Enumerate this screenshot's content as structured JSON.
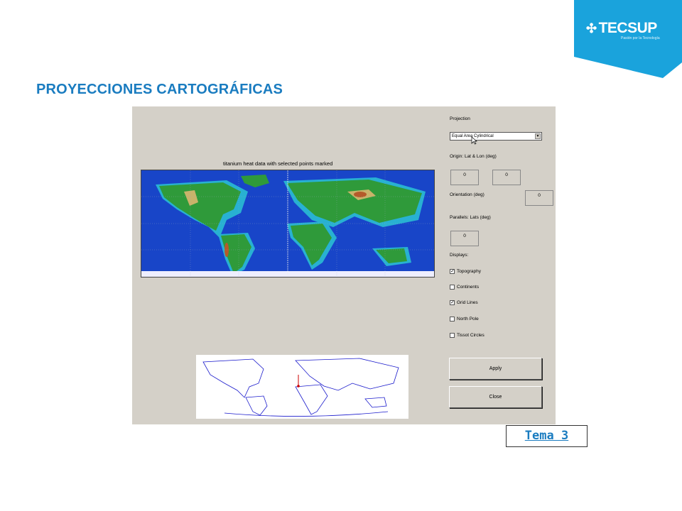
{
  "logo": {
    "brand": "TECSUP",
    "tagline": "Pasión por la Tecnología",
    "color": "#1aa3dc"
  },
  "slide": {
    "title": "PROYECCIONES CARTOGRÁFICAS",
    "title_color": "#1a7cc0",
    "tema_label": "Tema 3"
  },
  "app": {
    "plot_title": "titanium heat data with selected points marked",
    "projection_label": "Projection",
    "projection_value": "Equal Area Cylindrical",
    "origin_label": "Origin: Lat & Lon (deg)",
    "origin_lat": "0",
    "origin_lon": "0",
    "orientation_label": "Orientation (deg)",
    "orientation_value": "0",
    "parallels_label": "Parallels: Lats (deg)",
    "parallels_value": "0",
    "displays_label": "Displays:",
    "displays": [
      {
        "label": "Topography",
        "checked": true
      },
      {
        "label": "Continents",
        "checked": false
      },
      {
        "label": "Grid Lines",
        "checked": true
      },
      {
        "label": "North Pole",
        "checked": false
      },
      {
        "label": "Tissot Circles",
        "checked": false
      }
    ],
    "apply_label": "Apply",
    "close_label": "Close",
    "colors": {
      "ocean": "#1845c8",
      "land": "#2f9a3a",
      "shelf": "#2ed6d6",
      "panel": "#d4d0c8"
    }
  }
}
